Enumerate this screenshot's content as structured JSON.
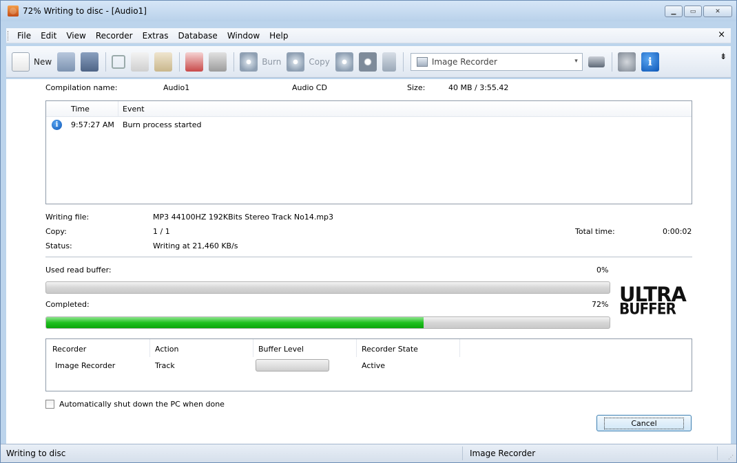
{
  "window": {
    "title": "72% Writing to disc - [Audio1]"
  },
  "menu": {
    "items": [
      "File",
      "Edit",
      "View",
      "Recorder",
      "Extras",
      "Database",
      "Window",
      "Help"
    ],
    "close": "×"
  },
  "toolbar": {
    "new_label": "New",
    "burn_label": "Burn",
    "copy_label": "Copy",
    "recorder_select": "Image Recorder"
  },
  "compilation": {
    "name_label": "Compilation name:",
    "name_value": "Audio1",
    "type": "Audio CD",
    "size_label": "Size:",
    "size_value": "40 MB  /  3:55.42"
  },
  "event_log": {
    "columns": [
      "Time",
      "Event"
    ],
    "rows": [
      {
        "time": "9:57:27 AM",
        "event": "Burn process started"
      }
    ]
  },
  "details": {
    "writing_file_label": "Writing file:",
    "writing_file_value": "MP3 44100HZ 192KBits Stereo Track No14.mp3",
    "copy_label": "Copy:",
    "copy_value": "1 / 1",
    "status_label": "Status:",
    "status_value": "Writing at 21,460 KB/s",
    "total_time_label": "Total time:",
    "total_time_value": "0:00:02"
  },
  "buffer": {
    "label": "Used read buffer:",
    "percent_text": "0%",
    "fraction": 0.0
  },
  "completed": {
    "label": "Completed:",
    "percent_text": "72%",
    "fraction": 0.67
  },
  "logo": {
    "line1": "ULTRA",
    "line2": "BUFFER"
  },
  "recorders": {
    "columns": [
      "Recorder",
      "Action",
      "Buffer Level",
      "Recorder State"
    ],
    "rows": [
      {
        "recorder": "Image Recorder",
        "action": "Track",
        "buffer_level": 0.0,
        "state": "Active"
      }
    ]
  },
  "shutdown": {
    "label": "Automatically shut down the PC when done",
    "checked": false
  },
  "cancel_label": "Cancel",
  "statusbar": {
    "left": "Writing to disc",
    "right": "Image Recorder"
  }
}
